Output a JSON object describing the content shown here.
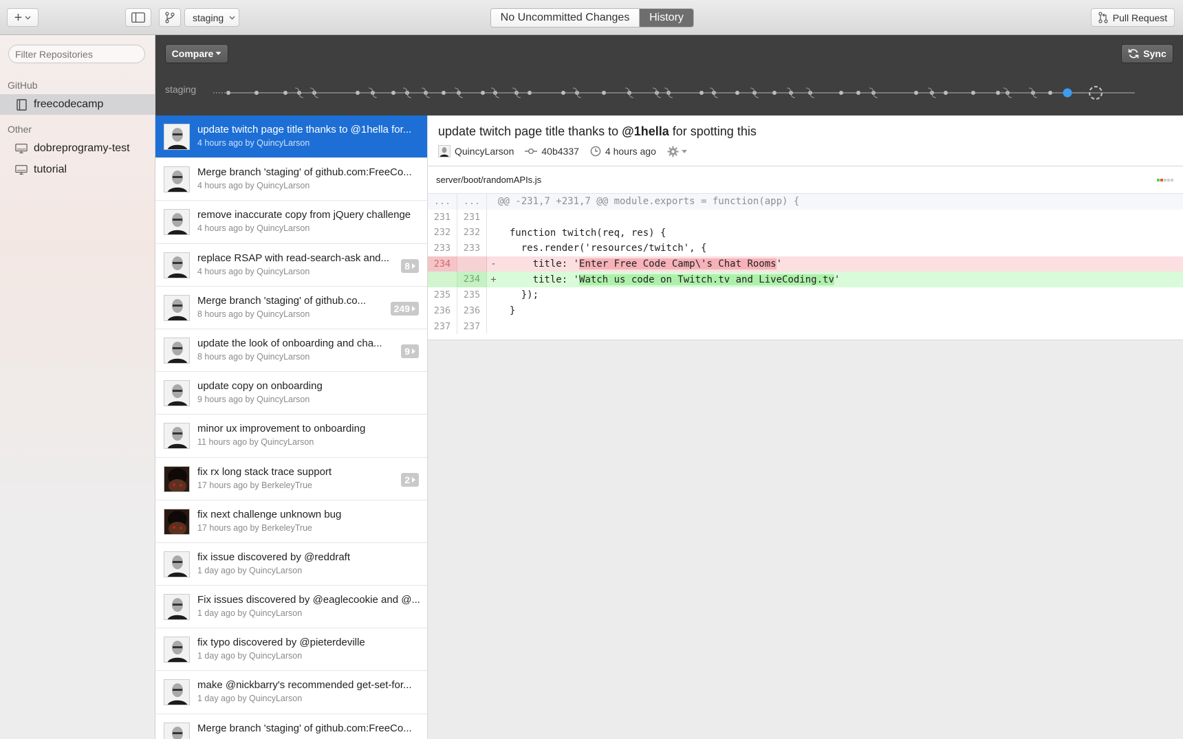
{
  "toolbar": {
    "add_glyph": "+",
    "branch": "staging",
    "segments": {
      "uncommitted": "No Uncommitted Changes",
      "history": "History"
    },
    "pull_request": "Pull Request"
  },
  "sidebar": {
    "filter_placeholder": "Filter Repositories",
    "github_header": "GitHub",
    "github_repos": [
      {
        "name": "freecodecamp",
        "icon": "book-icon"
      }
    ],
    "other_header": "Other",
    "other_repos": [
      {
        "name": "dobreprogramy-test",
        "icon": "computer-icon"
      },
      {
        "name": "tutorial",
        "icon": "computer-icon"
      }
    ]
  },
  "darkbar": {
    "compare": "Compare",
    "sync": "Sync",
    "branch": "staging"
  },
  "commits": [
    {
      "title": "update twitch page title thanks to @1hella for...",
      "meta": "4 hours ago by QuincyLarson",
      "selected": true
    },
    {
      "title": "Merge branch 'staging' of github.com:FreeCo...",
      "meta": "4 hours ago by QuincyLarson"
    },
    {
      "title": "remove inaccurate copy from jQuery challenge",
      "meta": "4 hours ago by QuincyLarson"
    },
    {
      "title": "replace RSAP with read-search-ask and...",
      "meta": "4 hours ago by QuincyLarson",
      "badge": "8"
    },
    {
      "title": "Merge branch 'staging' of github.co...",
      "meta": "8 hours ago by QuincyLarson",
      "badge": "249"
    },
    {
      "title": "update the look of onboarding and cha...",
      "meta": "8 hours ago by QuincyLarson",
      "badge": "9"
    },
    {
      "title": "update copy on onboarding",
      "meta": "9 hours ago by QuincyLarson"
    },
    {
      "title": "minor ux improvement to onboarding",
      "meta": "11 hours ago by QuincyLarson"
    },
    {
      "title": "fix rx long stack trace support",
      "meta": "17 hours ago by BerkeleyTrue",
      "badge": "2",
      "avatar": "dark"
    },
    {
      "title": "fix next challenge unknown bug",
      "meta": "17 hours ago by BerkeleyTrue",
      "avatar": "dark"
    },
    {
      "title": "fix issue discovered by @reddraft",
      "meta": "1 day ago by QuincyLarson"
    },
    {
      "title": "Fix issues discovered by @eaglecookie and @...",
      "meta": "1 day ago by QuincyLarson"
    },
    {
      "title": "fix typo discovered by @pieterdeville",
      "meta": "1 day ago by QuincyLarson"
    },
    {
      "title": "make @nickbarry's recommended get-set-for...",
      "meta": "1 day ago by QuincyLarson"
    },
    {
      "title": "Merge branch 'staging' of github.com:FreeCo...",
      "meta": ""
    }
  ],
  "detail": {
    "title_pre": "update twitch page title thanks to ",
    "title_bold": "@1hella",
    "title_post": " for spotting this",
    "author": "QuincyLarson",
    "sha": "40b4337",
    "time": "4 hours ago",
    "file": "server/boot/randomAPIs.js",
    "diff": [
      {
        "type": "hunk",
        "old": "...",
        "new": "...",
        "sign": "",
        "code": "@@ -231,7 +231,7 @@ module.exports = function(app) {"
      },
      {
        "type": "ctx",
        "old": "231",
        "new": "231",
        "sign": "",
        "code": ""
      },
      {
        "type": "ctx",
        "old": "232",
        "new": "232",
        "sign": "",
        "code": "  function twitch(req, res) {"
      },
      {
        "type": "ctx",
        "old": "233",
        "new": "233",
        "sign": "",
        "code": "    res.render('resources/twitch', {"
      },
      {
        "type": "del",
        "old": "234",
        "new": "",
        "sign": "-",
        "code_pre": "      title: '",
        "code_hl": "Enter Free Code Camp\\'s Chat Rooms",
        "code_post": "'"
      },
      {
        "type": "add",
        "old": "",
        "new": "234",
        "sign": "+",
        "code_pre": "      title: '",
        "code_hl": "Watch us code on Twitch.tv and LiveCoding.tv",
        "code_post": "'"
      },
      {
        "type": "ctx",
        "old": "235",
        "new": "235",
        "sign": "",
        "code": "    });"
      },
      {
        "type": "ctx",
        "old": "236",
        "new": "236",
        "sign": "",
        "code": "  }"
      },
      {
        "type": "ctx",
        "old": "237",
        "new": "237",
        "sign": "",
        "code": ""
      }
    ]
  }
}
